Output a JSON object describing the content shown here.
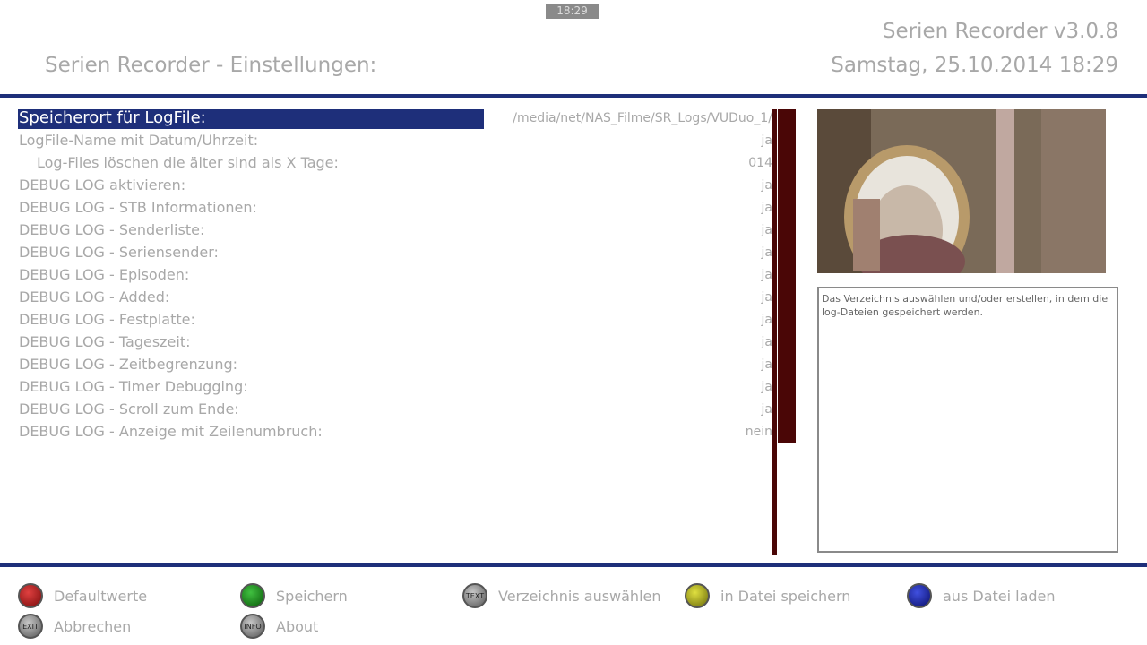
{
  "header": {
    "clock_badge": "18:29",
    "title": "Serien Recorder - Einstellungen:",
    "app_version": "Serien Recorder v3.0.8",
    "datetime": "Samstag, 25.10.2014  18:29"
  },
  "settings": [
    {
      "label": "Speicherort für LogFile:",
      "value": "/media/net/NAS_Filme/SR_Logs/VUDuo_1/"
    },
    {
      "label": "LogFile-Name mit Datum/Uhrzeit:",
      "value": "ja"
    },
    {
      "label": "Log-Files löschen die älter sind als X Tage:",
      "value": "014"
    },
    {
      "label": "DEBUG LOG aktivieren:",
      "value": "ja"
    },
    {
      "label": "DEBUG LOG - STB Informationen:",
      "value": "ja"
    },
    {
      "label": "DEBUG LOG - Senderliste:",
      "value": "ja"
    },
    {
      "label": "DEBUG LOG - Seriensender:",
      "value": "ja"
    },
    {
      "label": "DEBUG LOG - Episoden:",
      "value": "ja"
    },
    {
      "label": "DEBUG LOG - Added:",
      "value": "ja"
    },
    {
      "label": "DEBUG LOG - Festplatte:",
      "value": "ja"
    },
    {
      "label": "DEBUG LOG - Tageszeit:",
      "value": "ja"
    },
    {
      "label": "DEBUG LOG - Zeitbegrenzung:",
      "value": "ja"
    },
    {
      "label": "DEBUG LOG - Timer Debugging:",
      "value": "ja"
    },
    {
      "label": "DEBUG LOG - Scroll zum Ende:",
      "value": "ja"
    },
    {
      "label": "DEBUG LOG - Anzeige mit Zeilenumbruch:",
      "value": "nein"
    }
  ],
  "help": {
    "text": "Das Verzeichnis auswählen und/oder erstellen, in dem die log-Dateien gespeichert werden."
  },
  "keys": {
    "red": "Defaultwerte",
    "green": "Speichern",
    "text": "Verzeichnis auswählen",
    "text_key": "TEXT",
    "yellow": "in Datei speichern",
    "blue": "aus Datei laden",
    "exit": "Abbrechen",
    "exit_key": "EXIT",
    "info": "About",
    "info_key": "INFO"
  },
  "colors": {
    "accent": "#1e2f7a",
    "scrollbar": "#4a0606",
    "text": "#a8a8a8"
  }
}
